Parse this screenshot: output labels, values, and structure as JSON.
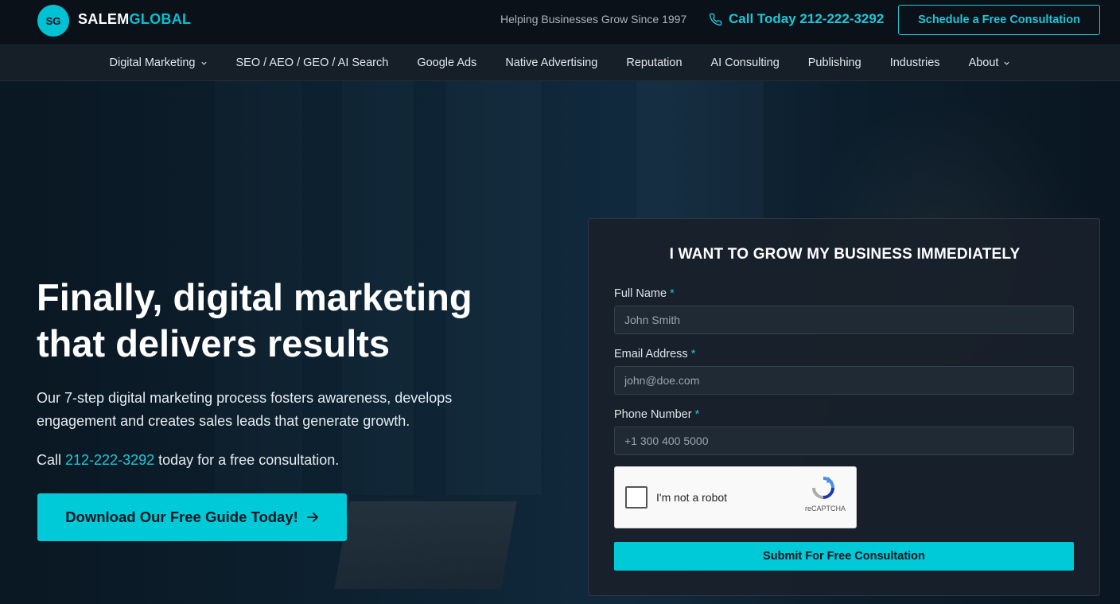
{
  "header": {
    "logo_badge": "SG",
    "logo_part1": "SALEM",
    "logo_part2": "GLOBAL",
    "tagline": "Helping Businesses Grow Since 1997",
    "phone_label": "Call Today 212-222-3292",
    "schedule_label": "Schedule a Free Consultation",
    "icons": {
      "phone": "phone-icon"
    }
  },
  "nav": {
    "items": [
      {
        "label": "Digital Marketing",
        "has_dropdown": true
      },
      {
        "label": "SEO / AEO / GEO / AI Search",
        "has_dropdown": false
      },
      {
        "label": "Google Ads",
        "has_dropdown": false
      },
      {
        "label": "Native Advertising",
        "has_dropdown": false
      },
      {
        "label": "Reputation",
        "has_dropdown": false
      },
      {
        "label": "AI Consulting",
        "has_dropdown": false
      },
      {
        "label": "Publishing",
        "has_dropdown": false
      },
      {
        "label": "Industries",
        "has_dropdown": false
      },
      {
        "label": "About",
        "has_dropdown": true
      }
    ]
  },
  "hero": {
    "headline_line1": "Finally, digital marketing",
    "headline_line2": "that delivers results",
    "subcopy": "Our 7-step digital marketing process fosters awareness, develops engagement and creates sales leads that generate growth.",
    "call_prefix": "Call ",
    "call_phone": "212-222-3292",
    "call_suffix": " today for a free consultation.",
    "cta_label": "Download Our Free Guide Today!"
  },
  "form": {
    "title": "I WANT TO GROW MY BUSINESS IMMEDIATELY",
    "required_marker": "*",
    "fields": [
      {
        "label": "Full Name",
        "placeholder": "John Smith"
      },
      {
        "label": "Email Address",
        "placeholder": "john@doe.com"
      },
      {
        "label": "Phone Number",
        "placeholder": "+1 300 400 5000"
      }
    ],
    "captcha_label": "I'm not a robot",
    "captcha_brand": "reCAPTCHA",
    "submit_label": "Submit For Free Consultation"
  },
  "colors": {
    "accent": "#00c9d8",
    "topbar_bg": "#0b1119",
    "nav_bg": "#161e28",
    "card_bg": "#18202a"
  }
}
